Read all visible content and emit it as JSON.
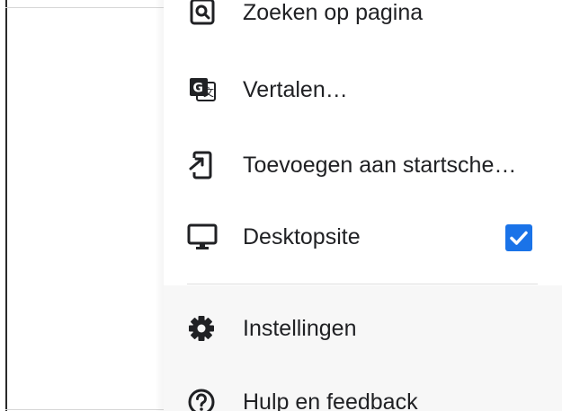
{
  "menu": {
    "items": [
      {
        "label": "Zoeken op pagina",
        "icon": "find-in-page-icon"
      },
      {
        "label": "Vertalen…",
        "icon": "translate-icon"
      },
      {
        "label": "Toevoegen aan startsche…",
        "icon": "add-to-home-screen-icon"
      },
      {
        "label": "Desktopsite",
        "icon": "desktop-icon",
        "checked": true
      },
      {
        "label": "Instellingen",
        "icon": "gear-icon"
      },
      {
        "label": "Hulp en feedback",
        "icon": "help-icon"
      }
    ]
  },
  "colors": {
    "accent": "#1a73e8",
    "text": "#202124",
    "icon": "#202124"
  }
}
